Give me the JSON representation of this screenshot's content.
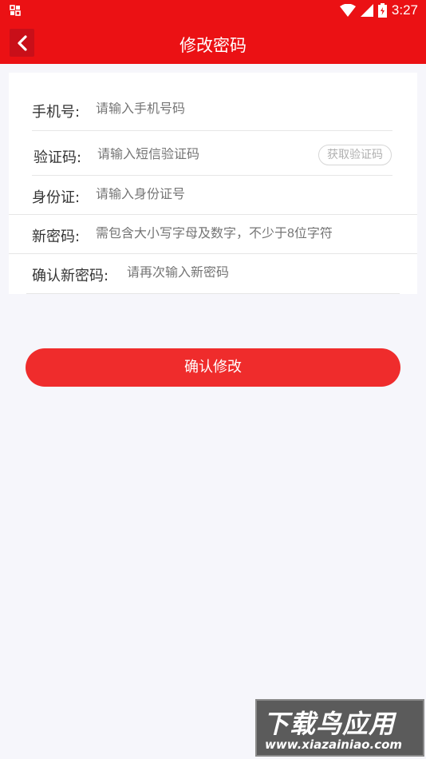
{
  "status_bar": {
    "time": "3:27",
    "icons": [
      "notification-icon",
      "wifi-icon",
      "signal-icon",
      "battery-icon"
    ]
  },
  "header": {
    "title": "修改密码",
    "back_icon": "chevron-left-icon"
  },
  "form": {
    "phone": {
      "label": "手机号:",
      "placeholder": "请输入手机号码"
    },
    "code": {
      "label": "验证码:",
      "placeholder": "请输入短信验证码",
      "button": "获取验证码"
    },
    "id_card": {
      "label": "身份证:",
      "placeholder": "请输入身份证号"
    },
    "new_password": {
      "label": "新密码:",
      "placeholder": "需包含大小写字母及数字，不少于8位字符"
    },
    "confirm_password": {
      "label": "确认新密码:",
      "placeholder": "请再次输入新密码"
    }
  },
  "confirm_button": "确认修改",
  "watermark": {
    "title": "下载鸟应用",
    "url": "www.xiazainiao.com"
  },
  "colors": {
    "brand_red": "#eb1114",
    "button_red": "#ef2c2c",
    "background": "#f6f6fb"
  }
}
